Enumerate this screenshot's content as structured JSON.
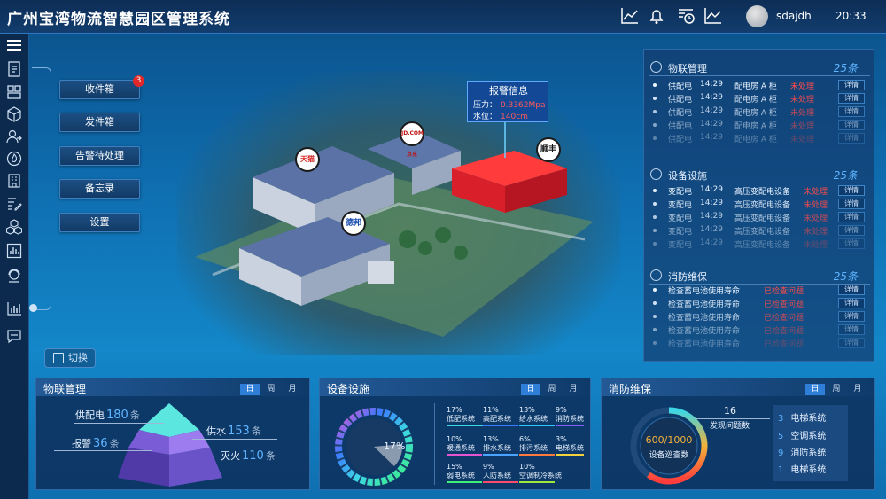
{
  "header": {
    "title": "广州宝湾物流智慧园区管理系统",
    "username": "sdajdh",
    "time": "20:33"
  },
  "left_menu": {
    "items": [
      {
        "label": "收件箱",
        "badge": "3"
      },
      {
        "label": "发件箱"
      },
      {
        "label": "告警待处理"
      },
      {
        "label": "备忘录"
      },
      {
        "label": "设置"
      }
    ],
    "switch_label": "切换"
  },
  "scene": {
    "alarm": {
      "title": "报警信息",
      "pressure_label": "压力：",
      "pressure_value": "0.3362Mpa",
      "level_label": "水位：",
      "level_value": "140cm"
    },
    "brands": [
      "天猫",
      "JD.COM 京东",
      "顺丰",
      "德邦"
    ]
  },
  "right_panel": {
    "sections": [
      {
        "title": "物联管理",
        "count": "25条",
        "rows": [
          {
            "type": "供配电",
            "time": "14:29",
            "place": "配电房 A 柜",
            "status": "未处理",
            "action": "详情"
          },
          {
            "type": "供配电",
            "time": "14:29",
            "place": "配电房 A 柜",
            "status": "未处理",
            "action": "详情"
          },
          {
            "type": "供配电",
            "time": "14:29",
            "place": "配电房 A 柜",
            "status": "未处理",
            "action": "详情"
          },
          {
            "type": "供配电",
            "time": "14:29",
            "place": "配电房 A 柜",
            "status": "未处理",
            "action": "详情"
          },
          {
            "type": "供配电",
            "time": "14:29",
            "place": "配电房 A 柜",
            "status": "未处理",
            "action": "详情"
          }
        ]
      },
      {
        "title": "设备设施",
        "count": "25条",
        "rows": [
          {
            "type": "变配电",
            "time": "14:29",
            "place": "高压变配电设备",
            "status": "未处理",
            "action": "详情"
          },
          {
            "type": "变配电",
            "time": "14:29",
            "place": "高压变配电设备",
            "status": "未处理",
            "action": "详情"
          },
          {
            "type": "变配电",
            "time": "14:29",
            "place": "高压变配电设备",
            "status": "未处理",
            "action": "详情"
          },
          {
            "type": "变配电",
            "time": "14:29",
            "place": "高压变配电设备",
            "status": "未处理",
            "action": "详情"
          },
          {
            "type": "变配电",
            "time": "14:29",
            "place": "高压变配电设备",
            "status": "未处理",
            "action": "详情"
          }
        ]
      },
      {
        "title": "消防维保",
        "count": "25条",
        "rows": [
          {
            "place": "检查蓄电池使用寿命",
            "status": "已检查问题",
            "action": "详情"
          },
          {
            "place": "检查蓄电池使用寿命",
            "status": "已检查问题",
            "action": "详情"
          },
          {
            "place": "检查蓄电池使用寿命",
            "status": "已检查问题",
            "action": "详情"
          },
          {
            "place": "检查蓄电池使用寿命",
            "status": "已检查问题",
            "action": "详情"
          },
          {
            "place": "检查蓄电池使用寿命",
            "status": "已检查问题",
            "action": "详情"
          }
        ]
      }
    ]
  },
  "bottom": {
    "tabs": [
      "日",
      "周",
      "月"
    ],
    "iot": {
      "title": "物联管理",
      "items": [
        {
          "label": "供配电",
          "value": "180",
          "unit": "条"
        },
        {
          "label": "供水",
          "value": "153",
          "unit": "条"
        },
        {
          "label": "报警",
          "value": "36",
          "unit": "条"
        },
        {
          "label": "灭火",
          "value": "110",
          "unit": "条"
        }
      ]
    },
    "equipment": {
      "title": "设备设施",
      "center_pct": "17%",
      "systems": [
        {
          "pct": "17%",
          "name": "低配系统",
          "color": "#3cd6e6"
        },
        {
          "pct": "11%",
          "name": "高配系统",
          "color": "#3a7bff"
        },
        {
          "pct": "13%",
          "name": "给水系统",
          "color": "#2fc7ff"
        },
        {
          "pct": "9%",
          "name": "消防系统",
          "color": "#8a5cff"
        },
        {
          "pct": "10%",
          "name": "暖通系统",
          "color": "#e655d0"
        },
        {
          "pct": "13%",
          "name": "排水系统",
          "color": "#4aa3ff"
        },
        {
          "pct": "6%",
          "name": "排污系统",
          "color": "#ff7a3c"
        },
        {
          "pct": "3%",
          "name": "电梯系统",
          "color": "#f2d23a"
        },
        {
          "pct": "15%",
          "name": "弱电系统",
          "color": "#3cf07a"
        },
        {
          "pct": "9%",
          "name": "人防系统",
          "color": "#ff4a6e"
        },
        {
          "pct": "10%",
          "name": "空调制冷系统",
          "color": "#a0e63c"
        }
      ]
    },
    "fire": {
      "title": "消防维保",
      "gauge_value": "600/1000",
      "gauge_label": "设备巡查数",
      "issues_count": "16",
      "issues_label": "发现问题数",
      "list": [
        {
          "n": "3",
          "name": "电梯系统"
        },
        {
          "n": "5",
          "name": "空调系统"
        },
        {
          "n": "9",
          "name": "消防系统"
        },
        {
          "n": "1",
          "name": "电梯系统"
        }
      ]
    }
  }
}
